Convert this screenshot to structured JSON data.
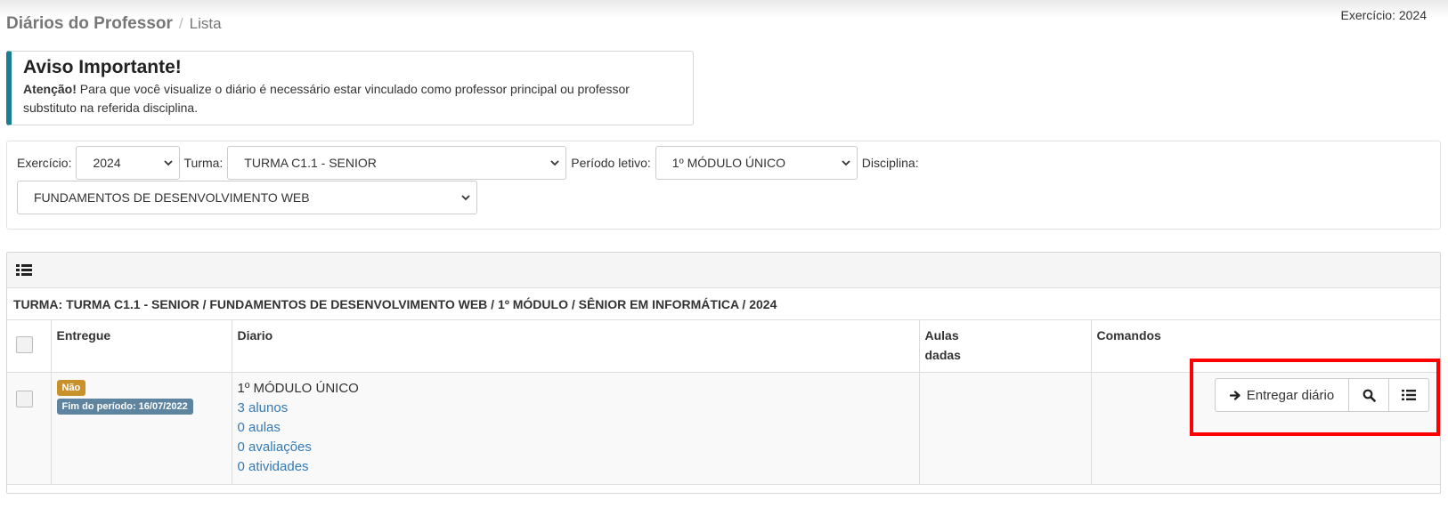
{
  "header": {
    "title": "Diários do Professor",
    "separator": "/",
    "crumb": "Lista",
    "exercicio_text": "Exercício: 2024"
  },
  "alert": {
    "title": "Aviso Importante!",
    "strong": "Atenção!",
    "message": " Para que você visualize o diário é necessário estar vinculado como professor principal ou professor substituto na referida disciplina."
  },
  "filters": {
    "exercicio_label": "Exercício:",
    "exercicio_value": "2024",
    "turma_label": "Turma:",
    "turma_value": "TURMA C1.1 - SENIOR",
    "periodo_label": "Período letivo:",
    "periodo_value": "1º MÓDULO ÚNICO",
    "disciplina_label": "Disciplina:",
    "disciplina_value": "FUNDAMENTOS DE DESENVOLVIMENTO WEB"
  },
  "panel": {
    "caption": "TURMA: TURMA C1.1 - SENIOR / FUNDAMENTOS DE DESENVOLVIMENTO WEB / 1º MÓDULO / SÊNIOR EM INFORMÁTICA / 2024",
    "columns": {
      "entregue": "Entregue",
      "diario": "Diario",
      "aulas_dadas_1": "Aulas",
      "aulas_dadas_2": "dadas",
      "comandos": "Comandos"
    },
    "row": {
      "status_badge": "Não",
      "fim_badge": "Fim do período: 16/07/2022",
      "diario_title": "1º MÓDULO ÚNICO",
      "alunos": "3 alunos",
      "aulas": "0 aulas",
      "avaliacoes": "0 avaliações",
      "atividades": "0 atividades",
      "aulas_dadas": ""
    }
  },
  "commands": {
    "entregar_label": "Entregar diário"
  },
  "icons": {
    "list": "list-icon",
    "search": "search-icon",
    "arrow": "arrow-right-icon"
  },
  "colors": {
    "badge_nao": "#c8912a",
    "badge_fim": "#5e84a0",
    "link": "#337ab7",
    "alert_border": "#1b7d91",
    "highlight": "#ff0000"
  }
}
